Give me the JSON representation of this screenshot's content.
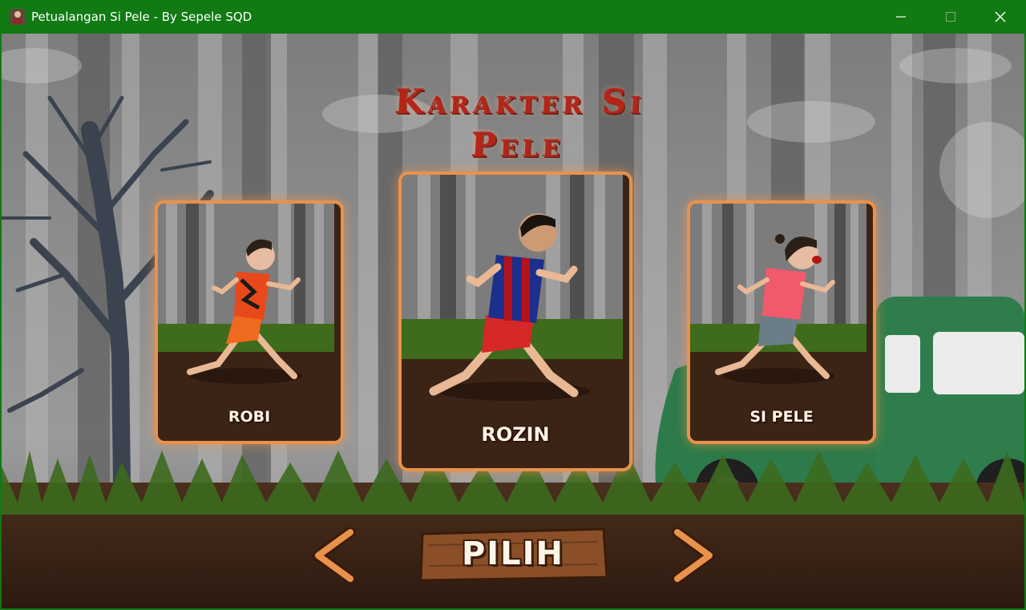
{
  "window": {
    "title": "Petualangan Si Pele - By Sepele SQD",
    "titlebar_color": "#117a13",
    "controls": [
      "minimize-icon",
      "maximize-icon",
      "close-icon"
    ]
  },
  "game": {
    "heading": "Karakter Si Pele",
    "characters": [
      {
        "name": "ROBI",
        "shirt_color": "#e8491b",
        "pants_color": "#ef6a1f",
        "selected": false
      },
      {
        "name": "ROZIN",
        "shirt_color": "#1d2f8c",
        "pants_color": "#d62828",
        "selected": true
      },
      {
        "name": "SI PELE",
        "shirt_color": "#f05a6a",
        "pants_color": "#6b7d86",
        "selected": false
      }
    ],
    "select_button": "PILIH",
    "nav": {
      "prev_icon": "chevron-left-icon",
      "next_icon": "chevron-right-icon"
    },
    "colors": {
      "card_border": "#e8924c",
      "title_red": "#b62418",
      "ground": "#3b2416"
    }
  }
}
